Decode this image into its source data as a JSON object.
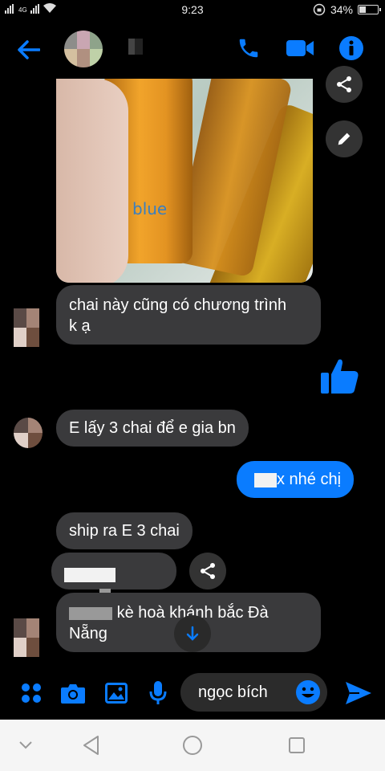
{
  "status": {
    "network": "4G",
    "time": "9:23",
    "battery": "34%",
    "battery_level": 0.34
  },
  "header": {
    "contact_name_hidden": true
  },
  "messages": [
    {
      "id": "m1",
      "text_line1": "chai này cũng có chương trình",
      "text_line2": "k ạ"
    },
    {
      "id": "m2",
      "text": "E lấy 3 chai để e gia bn"
    },
    {
      "id": "m3",
      "text": "x nhé chị"
    },
    {
      "id": "m4",
      "text": "ship ra E 3 chai"
    },
    {
      "id": "m6",
      "text_line1": "kè hoà khánh bắc Đà",
      "text_line2": "Nẵng"
    }
  ],
  "composer": {
    "input_value": "ngọc bích"
  },
  "colors": {
    "accent": "#0a7cff",
    "bubble_other": "#3a3a3c",
    "background": "#000000"
  }
}
